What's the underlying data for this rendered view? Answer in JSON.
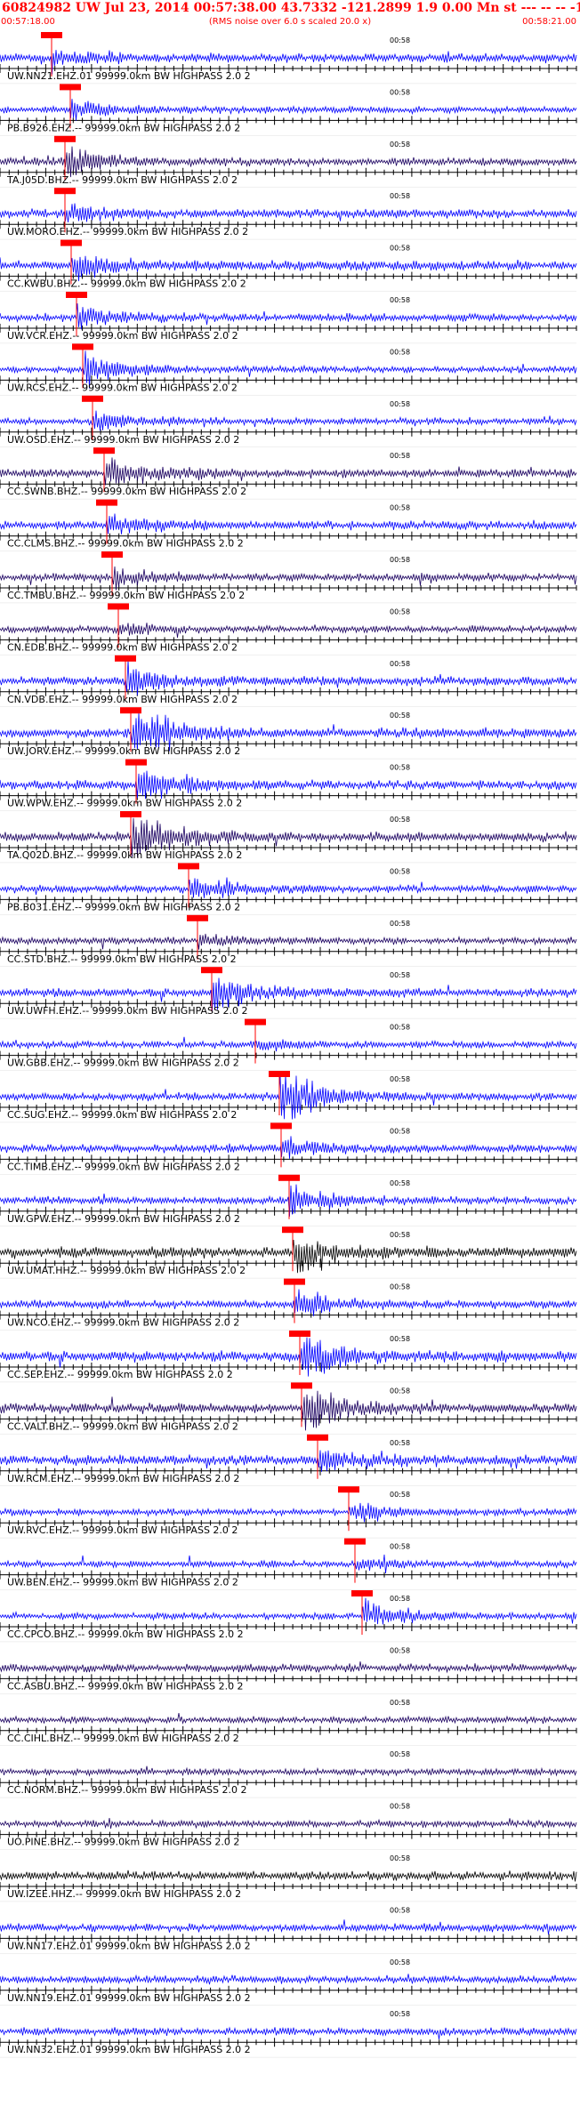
{
  "header": {
    "title": "60824982 UW Jul 23, 2014 00:57:38.00   43.7332 -121.2899  1.9 0.00 Mn st --- -- --  -1",
    "subtitle": "(RMS noise over 6.0 s scaled 20.0 x)",
    "start_time": "00:57:18.00",
    "end_time": "00:58:21.00"
  },
  "minute_mark": "00:58",
  "colors": {
    "header_text": "#ff0000",
    "phase_marker": "#ff0000",
    "trace_blue": "#0000ff",
    "trace_navy": "#1a0060",
    "trace_black": "#000000"
  },
  "traces": [
    {
      "label": "UW.NN21.EHZ.01  99999.0km BW  HIGHPASS  2.0  2",
      "pick": 58,
      "color": "blue",
      "amp": 0.5,
      "event": 0.4
    },
    {
      "label": "PB.B926.EHZ.--  99999.0km BW  HIGHPASS  2.0  2",
      "pick": 79,
      "color": "blue",
      "amp": 0.3,
      "event": 0.5
    },
    {
      "label": "TA.J05D.BHZ.--  99999.0km BW  HIGHPASS  2.0  2",
      "pick": 73,
      "color": "navy",
      "amp": 0.4,
      "event": 0.8
    },
    {
      "label": "UW.MORO.EHZ.--  99999.0km BW  HIGHPASS  2.0  2",
      "pick": 73,
      "color": "blue",
      "amp": 0.5,
      "event": 0.5
    },
    {
      "label": "CC.KWBU.BHZ.--  99999.0km BW  HIGHPASS  2.0  2",
      "pick": 80,
      "color": "blue",
      "amp": 0.6,
      "event": 0.8
    },
    {
      "label": "UW.VCR.EHZ.--  99999.0km BW  HIGHPASS  2.0  2",
      "pick": 86,
      "color": "blue",
      "amp": 0.4,
      "event": 0.6
    },
    {
      "label": "UW.RCS.EHZ.--  99999.0km BW  HIGHPASS  2.0  2",
      "pick": 93,
      "color": "blue",
      "amp": 0.3,
      "event": 0.9
    },
    {
      "label": "UW.OSD.EHZ.--  99999.0km BW  HIGHPASS  2.0  2",
      "pick": 104,
      "color": "blue",
      "amp": 0.3,
      "event": 0.5
    },
    {
      "label": "CC.SWNB.BHZ.--  99999.0km BW  HIGHPASS  2.0  2",
      "pick": 117,
      "color": "navy",
      "amp": 0.5,
      "event": 0.9
    },
    {
      "label": "CC.CLMS.BHZ.--  99999.0km BW  HIGHPASS  2.0  2",
      "pick": 120,
      "color": "blue",
      "amp": 0.5,
      "event": 0.6
    },
    {
      "label": "CC.TMBU.BHZ.--  99999.0km BW  HIGHPASS  2.0  2",
      "pick": 126,
      "color": "navy",
      "amp": 0.4,
      "event": 0.6
    },
    {
      "label": "CN.EDB.BHZ.--  99999.0km BW  HIGHPASS  2.0  2",
      "pick": 133,
      "color": "navy",
      "amp": 0.3,
      "event": 0.3
    },
    {
      "label": "CN.VDB.EHZ.--  99999.0km BW  HIGHPASS  2.0  2",
      "pick": 141,
      "color": "blue",
      "amp": 0.5,
      "event": 0.9
    },
    {
      "label": "UW.JORV.EHZ.--  99999.0km BW  HIGHPASS  2.0  2",
      "pick": 147,
      "color": "blue",
      "amp": 0.6,
      "event": 1.6
    },
    {
      "label": "UW.WPW.EHZ.--  99999.0km BW  HIGHPASS  2.0  2",
      "pick": 153,
      "color": "blue",
      "amp": 0.5,
      "event": 1.2
    },
    {
      "label": "TA.Q02D.BHZ.--  99999.0km BW  HIGHPASS  2.0  2",
      "pick": 147,
      "color": "navy",
      "amp": 0.6,
      "event": 1.5
    },
    {
      "label": "PB.B031.EHZ.--  99999.0km BW  HIGHPASS  2.0  2",
      "pick": 212,
      "color": "blue",
      "amp": 0.4,
      "event": 0.7
    },
    {
      "label": "CC.STD.BHZ.--  99999.0km BW  HIGHPASS  2.0  2",
      "pick": 222,
      "color": "navy",
      "amp": 0.3,
      "event": 0.3
    },
    {
      "label": "UW.UWFH.EHZ.--  99999.0km BW  HIGHPASS  2.0  2",
      "pick": 238,
      "color": "blue",
      "amp": 0.5,
      "event": 1.0
    },
    {
      "label": "UW.GBB.EHZ.--  99999.0km BW  HIGHPASS  2.0  2",
      "pick": 287,
      "color": "blue",
      "amp": 0.3,
      "event": 0.3
    },
    {
      "label": "CC.SUG.EHZ.--  99999.0km BW  HIGHPASS  2.0  2",
      "pick": 314,
      "color": "blue",
      "amp": 0.4,
      "event": 1.6
    },
    {
      "label": "CC.TIMB.EHZ.--  99999.0km BW  HIGHPASS  2.0  2",
      "pick": 316,
      "color": "blue",
      "amp": 0.4,
      "event": 0.6
    },
    {
      "label": "UW.GPW.EHZ.--  99999.0km BW  HIGHPASS  2.0  2",
      "pick": 325,
      "color": "blue",
      "amp": 0.4,
      "event": 0.8
    },
    {
      "label": "UW.UMAT.HHZ.--  99999.0km BW  HIGHPASS  2.0  2",
      "pick": 329,
      "color": "black",
      "amp": 0.7,
      "event": 1.0
    },
    {
      "label": "UW.NCO.EHZ.--  99999.0km BW  HIGHPASS  2.0  2",
      "pick": 331,
      "color": "blue",
      "amp": 0.4,
      "event": 0.8
    },
    {
      "label": "CC.SEP.EHZ.--  99999.0km BW  HIGHPASS  2.0  2",
      "pick": 337,
      "color": "blue",
      "amp": 0.7,
      "event": 1.3
    },
    {
      "label": "CC.VALT.BHZ.--  99999.0km BW  HIGHPASS  2.0  2",
      "pick": 339,
      "color": "navy",
      "amp": 0.6,
      "event": 1.4
    },
    {
      "label": "UW.RCM.EHZ.--  99999.0km BW  HIGHPASS  2.0  2",
      "pick": 357,
      "color": "blue",
      "amp": 0.6,
      "event": 0.6
    },
    {
      "label": "UW.RVC.EHZ.--  99999.0km BW  HIGHPASS  2.0  2",
      "pick": 392,
      "color": "blue",
      "amp": 0.3,
      "event": 0.6
    },
    {
      "label": "UW.BEN.EHZ.--  99999.0km BW  HIGHPASS  2.0  2",
      "pick": 399,
      "color": "blue",
      "amp": 0.3,
      "event": 0.3
    },
    {
      "label": "CC.CPCO.BHZ.--  99999.0km BW  HIGHPASS  2.0  2",
      "pick": 407,
      "color": "blue",
      "amp": 0.3,
      "event": 0.9
    },
    {
      "label": "CC.ASBU.BHZ.--  99999.0km BW  HIGHPASS  2.0  2",
      "pick": null,
      "color": "navy",
      "amp": 0.4,
      "event": 0
    },
    {
      "label": "CC.CIHL.BHZ.--  99999.0km BW  HIGHPASS  2.0  2",
      "pick": null,
      "color": "navy",
      "amp": 0.3,
      "event": 0
    },
    {
      "label": "CC.NORM.BHZ.--  99999.0km BW  HIGHPASS  2.0  2",
      "pick": null,
      "color": "navy",
      "amp": 0.3,
      "event": 0
    },
    {
      "label": "UO.PINE.BHZ.--  99999.0km BW  HIGHPASS  2.0  2",
      "pick": null,
      "color": "navy",
      "amp": 0.3,
      "event": 0
    },
    {
      "label": "UW.IZEE.HHZ.--  99999.0km BW  HIGHPASS  2.0  2",
      "pick": null,
      "color": "black",
      "amp": 0.5,
      "event": 0
    },
    {
      "label": "UW.NN17.EHZ.01  99999.0km BW  HIGHPASS  2.0  2",
      "pick": null,
      "color": "blue",
      "amp": 0.4,
      "event": 0
    },
    {
      "label": "UW.NN19.EHZ.01  99999.0km BW  HIGHPASS  2.0  2",
      "pick": null,
      "color": "blue",
      "amp": 0.4,
      "event": 0
    },
    {
      "label": "UW.NN32.EHZ.01  99999.0km BW  HIGHPASS  2.0  2",
      "pick": null,
      "color": "blue",
      "amp": 0.4,
      "event": 0
    }
  ]
}
